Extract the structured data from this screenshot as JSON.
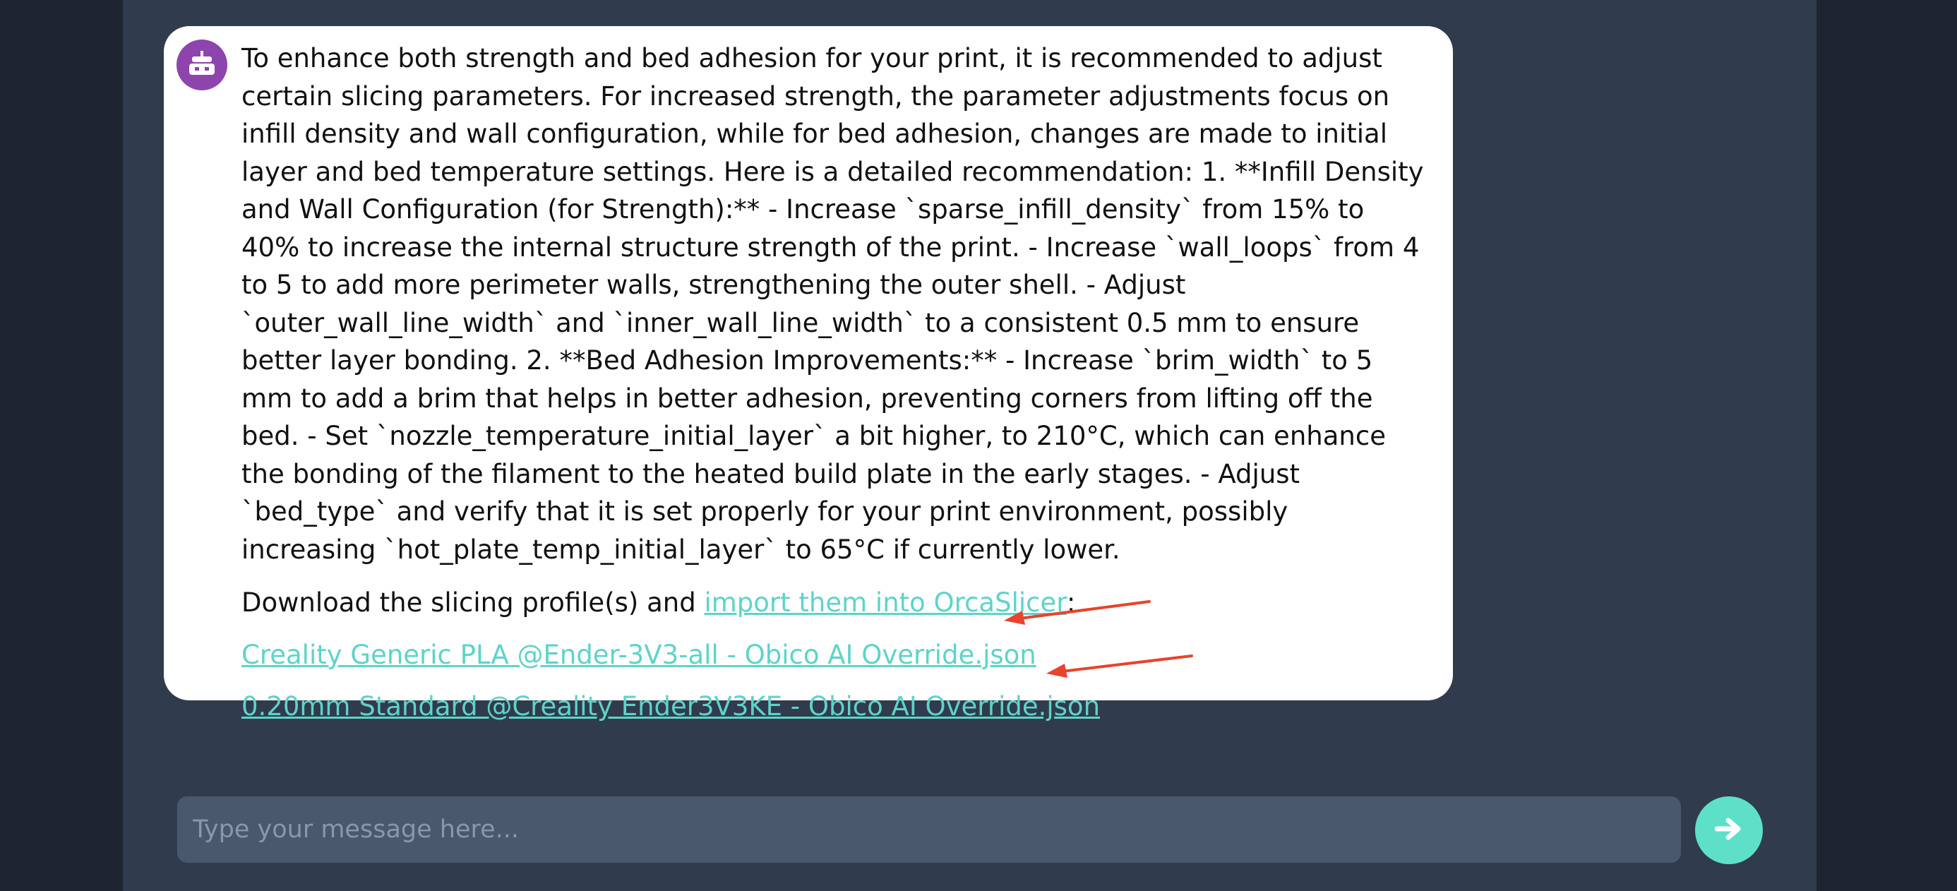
{
  "assistant": {
    "avatar_icon": "robot-icon",
    "avatar_color": "#8e44ad",
    "message": "To enhance both strength and bed adhesion for your print, it is recommended to adjust certain slicing parameters. For increased strength, the parameter adjustments focus on infill density and wall configuration, while for bed adhesion, changes are made to initial layer and bed temperature settings. Here is a detailed recommendation: 1. **Infill Density and Wall Configuration (for Strength):** - Increase `sparse_infill_density` from 15% to 40% to increase the internal structure strength of the print. - Increase `wall_loops` from 4 to 5 to add more perimeter walls, strengthening the outer shell. - Adjust `outer_wall_line_width` and `inner_wall_line_width` to a consistent 0.5 mm to ensure better layer bonding. 2. **Bed Adhesion Improvements:** - Increase `brim_width` to 5 mm to add a brim that helps in better adhesion, preventing corners from lifting off the bed. - Set `nozzle_temperature_initial_layer` a bit higher, to 210°C, which can enhance the bonding of the filament to the heated build plate in the early stages. - Adjust `bed_type` and verify that it is set properly for your print environment, possibly increasing `hot_plate_temp_initial_layer` to 65°C if currently lower.",
    "download_prefix": "Download the slicing profile(s) and ",
    "import_link": "import them into OrcaSlicer",
    "download_suffix": ":",
    "profiles": [
      "Creality Generic PLA @Ender-3V3-all - Obico AI Override.json",
      "0.20mm Standard @Creality Ender3V3KE - Obico AI Override.json"
    ]
  },
  "composer": {
    "placeholder": "Type your message here...",
    "send_icon": "arrow-right-icon"
  },
  "colors": {
    "link": "#5dd4c8",
    "send_button": "#5ee0c8",
    "annotation_arrow": "#e8432c"
  }
}
